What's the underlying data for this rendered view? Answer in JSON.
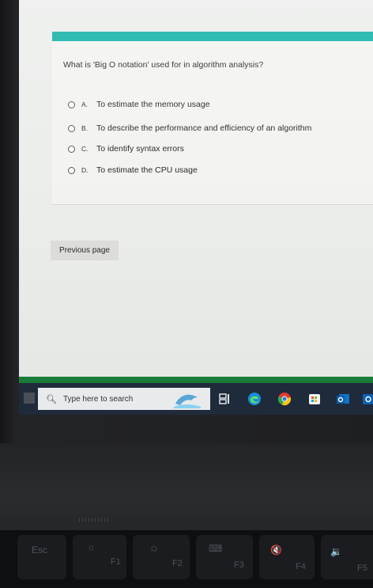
{
  "quiz": {
    "question": "What is 'Big O notation' used for in algorithm analysis?",
    "options": [
      {
        "letter": "A.",
        "text": "To estimate the memory usage"
      },
      {
        "letter": "B.",
        "text": "To describe the performance and efficiency of an algorithm"
      },
      {
        "letter": "C.",
        "text": "To identify syntax errors"
      },
      {
        "letter": "D.",
        "text": "To estimate the CPU usage"
      }
    ],
    "previous_label": "Previous page"
  },
  "taskbar": {
    "search_placeholder": "Type here to search",
    "icons": [
      "task-view-icon",
      "edge-icon",
      "chrome-icon",
      "store-icon",
      "outlook-icon",
      "office-icon"
    ]
  },
  "keyboard": {
    "keys": [
      {
        "label": "Esc",
        "glyph": ""
      },
      {
        "label": "F1",
        "glyph": "☼"
      },
      {
        "label": "F2",
        "glyph": "☼"
      },
      {
        "label": "F3",
        "glyph": "⌨"
      },
      {
        "label": "F4",
        "glyph": "🔇"
      },
      {
        "label": "F5",
        "glyph": "🔉"
      }
    ]
  },
  "colors": {
    "accent_teal": "#17b2a8",
    "taskbar": "#1f2a3a",
    "screen_bg": "#eceeec"
  }
}
